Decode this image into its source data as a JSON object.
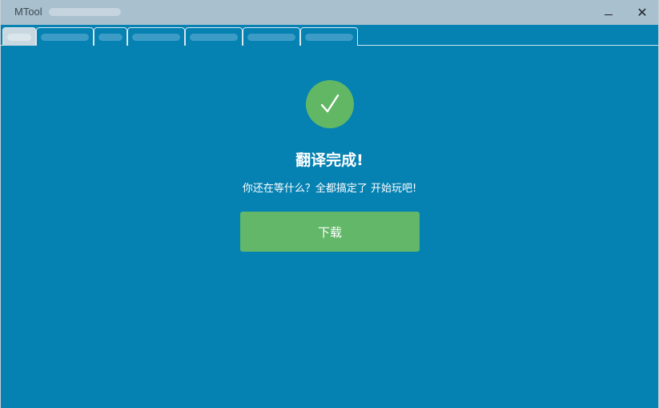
{
  "window": {
    "title": "MTool",
    "minimize_symbol": "",
    "close_symbol": "✕"
  },
  "tabs": [
    {
      "label": "",
      "active": true
    },
    {
      "label": "",
      "active": false
    },
    {
      "label": "",
      "active": false
    },
    {
      "label": "",
      "active": false
    },
    {
      "label": "",
      "active": false
    },
    {
      "label": "",
      "active": false
    },
    {
      "label": "",
      "active": false
    }
  ],
  "main": {
    "status_icon": "checkmark-icon",
    "heading": "翻译完成!",
    "subtitle": "你还在等什么？全都搞定了 开始玩吧!",
    "download_label": "下载"
  },
  "colors": {
    "background": "#0581b2",
    "titlebar": "#a9c0cf",
    "accent_green": "#62b868"
  }
}
